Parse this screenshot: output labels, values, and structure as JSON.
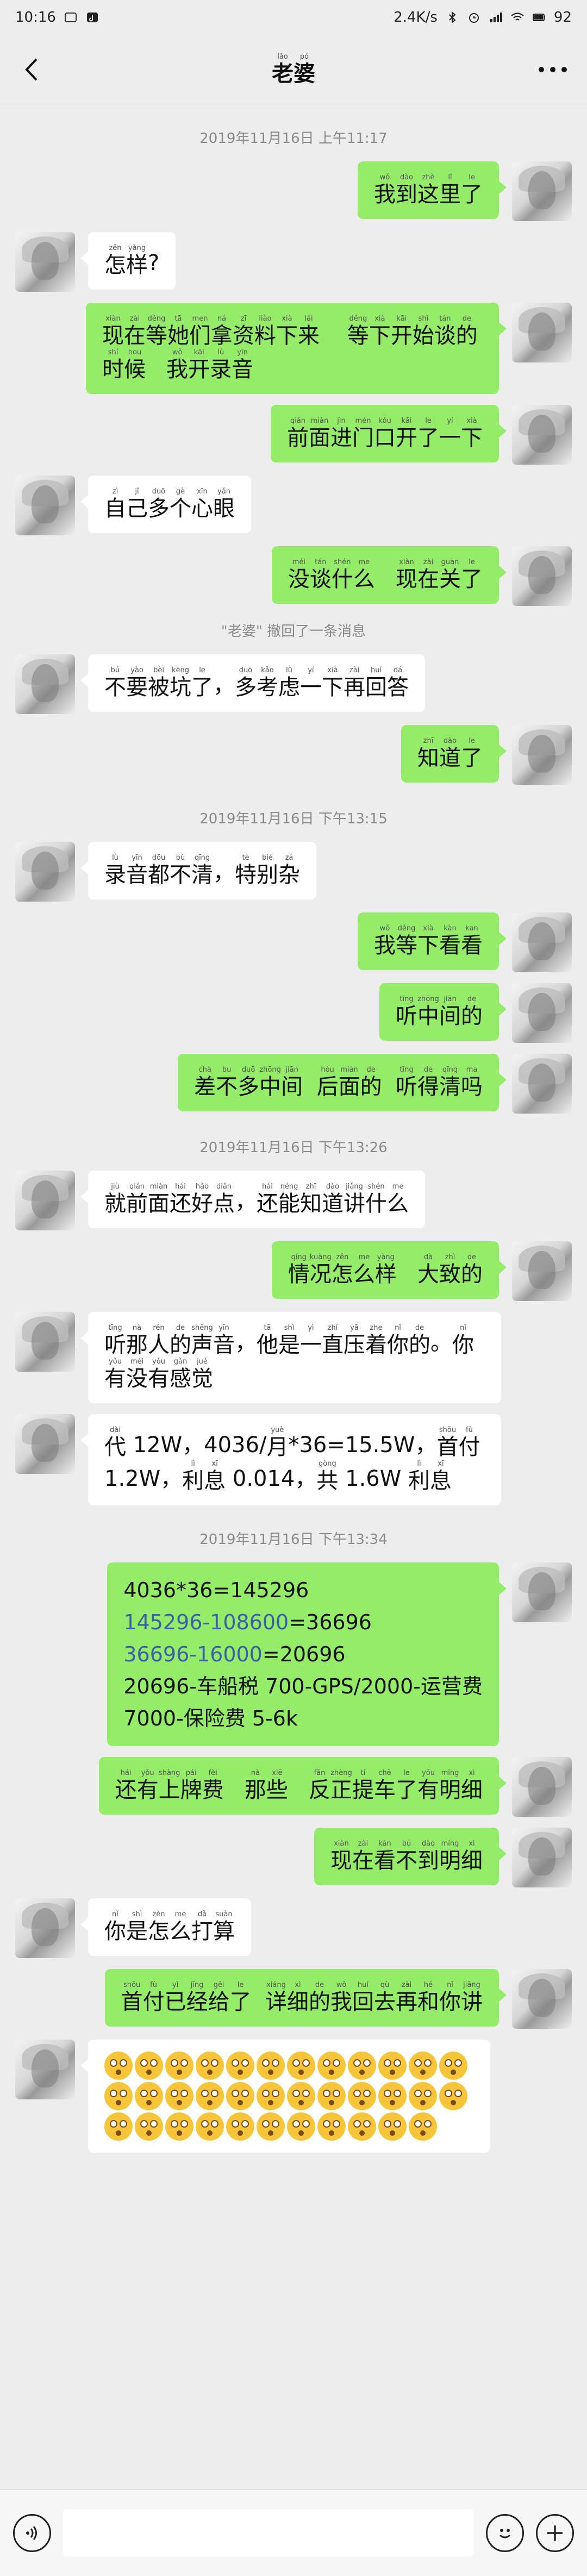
{
  "status": {
    "time": "10:16",
    "speed": "2.4K/s",
    "battery": "92"
  },
  "nav": {
    "title": [
      {
        "py": "lǎo",
        "hz": "老"
      },
      {
        "py": "pó",
        "hz": "婆"
      }
    ],
    "back_icon": "chevron-left-icon",
    "more_icon": "more-dots-icon"
  },
  "messages": [
    {
      "type": "time",
      "text": "2019年11月16日 上午11:17"
    },
    {
      "type": "msg",
      "side": "me",
      "segs": [
        {
          "py": "wǒ",
          "hz": "我"
        },
        {
          "py": "dào",
          "hz": "到"
        },
        {
          "py": "zhè",
          "hz": "这"
        },
        {
          "py": "lǐ",
          "hz": "里"
        },
        {
          "py": "le",
          "hz": "了"
        }
      ]
    },
    {
      "type": "msg",
      "side": "them",
      "segs": [
        {
          "py": "zěn",
          "hz": "怎"
        },
        {
          "py": "yàng",
          "hz": "样"
        },
        {
          "py": "",
          "hz": "?"
        }
      ]
    },
    {
      "type": "msg",
      "side": "me",
      "segs": [
        {
          "py": "xiàn",
          "hz": "现"
        },
        {
          "py": "zài",
          "hz": "在"
        },
        {
          "py": "děng",
          "hz": "等"
        },
        {
          "py": "tā",
          "hz": "她"
        },
        {
          "py": "men",
          "hz": "们"
        },
        {
          "py": "ná",
          "hz": "拿"
        },
        {
          "py": "zī",
          "hz": "资"
        },
        {
          "py": "liào",
          "hz": "料"
        },
        {
          "py": "xià",
          "hz": "下"
        },
        {
          "py": "lái",
          "hz": "来"
        },
        {
          "py": "",
          "hz": "    "
        },
        {
          "py": "děng",
          "hz": "等"
        },
        {
          "py": "xià",
          "hz": "下"
        },
        {
          "py": "kāi",
          "hz": "开"
        },
        {
          "py": "shǐ",
          "hz": "始"
        },
        {
          "py": "tán",
          "hz": "谈"
        },
        {
          "py": "de",
          "hz": "的"
        },
        {
          "py": "shí",
          "hz": "时"
        },
        {
          "py": "hou",
          "hz": "候"
        },
        {
          "py": "",
          "hz": "   "
        },
        {
          "py": "wǒ",
          "hz": "我"
        },
        {
          "py": "kāi",
          "hz": "开"
        },
        {
          "py": "lù",
          "hz": "录"
        },
        {
          "py": "yīn",
          "hz": "音"
        }
      ]
    },
    {
      "type": "msg",
      "side": "me",
      "segs": [
        {
          "py": "qián",
          "hz": "前"
        },
        {
          "py": "miàn",
          "hz": "面"
        },
        {
          "py": "jìn",
          "hz": "进"
        },
        {
          "py": "mén",
          "hz": "门"
        },
        {
          "py": "kǒu",
          "hz": "口"
        },
        {
          "py": "kāi",
          "hz": "开"
        },
        {
          "py": "le",
          "hz": "了"
        },
        {
          "py": "yí",
          "hz": "一"
        },
        {
          "py": "xià",
          "hz": "下"
        }
      ]
    },
    {
      "type": "msg",
      "side": "them",
      "segs": [
        {
          "py": "zì",
          "hz": "自"
        },
        {
          "py": "jǐ",
          "hz": "己"
        },
        {
          "py": "duō",
          "hz": "多"
        },
        {
          "py": "gè",
          "hz": "个"
        },
        {
          "py": "xīn",
          "hz": "心"
        },
        {
          "py": "yǎn",
          "hz": "眼"
        }
      ]
    },
    {
      "type": "msg",
      "side": "me",
      "segs": [
        {
          "py": "méi",
          "hz": "没"
        },
        {
          "py": "tán",
          "hz": "谈"
        },
        {
          "py": "shén",
          "hz": "什"
        },
        {
          "py": "me",
          "hz": "么"
        },
        {
          "py": "",
          "hz": "   "
        },
        {
          "py": "xiàn",
          "hz": "现"
        },
        {
          "py": "zài",
          "hz": "在"
        },
        {
          "py": "guān",
          "hz": "关"
        },
        {
          "py": "le",
          "hz": "了"
        }
      ]
    },
    {
      "type": "recall",
      "text": "\"老婆\" 撤回了一条消息"
    },
    {
      "type": "msg",
      "side": "them",
      "segs": [
        {
          "py": "bú",
          "hz": "不"
        },
        {
          "py": "yào",
          "hz": "要"
        },
        {
          "py": "bèi",
          "hz": "被"
        },
        {
          "py": "kēng",
          "hz": "坑"
        },
        {
          "py": "le",
          "hz": "了"
        },
        {
          "py": "",
          "hz": "，"
        },
        {
          "py": "duō",
          "hz": "多"
        },
        {
          "py": "kǎo",
          "hz": "考"
        },
        {
          "py": "lǜ",
          "hz": "虑"
        },
        {
          "py": "yí",
          "hz": "一"
        },
        {
          "py": "xià",
          "hz": "下"
        },
        {
          "py": "zài",
          "hz": "再"
        },
        {
          "py": "huí",
          "hz": "回"
        },
        {
          "py": "dá",
          "hz": "答"
        }
      ]
    },
    {
      "type": "msg",
      "side": "me",
      "segs": [
        {
          "py": "zhī",
          "hz": "知"
        },
        {
          "py": "dào",
          "hz": "道"
        },
        {
          "py": "le",
          "hz": "了"
        }
      ]
    },
    {
      "type": "time",
      "text": "2019年11月16日 下午13:15"
    },
    {
      "type": "msg",
      "side": "them",
      "segs": [
        {
          "py": "lù",
          "hz": "录"
        },
        {
          "py": "yīn",
          "hz": "音"
        },
        {
          "py": "dōu",
          "hz": "都"
        },
        {
          "py": "bù",
          "hz": "不"
        },
        {
          "py": "qīng",
          "hz": "清"
        },
        {
          "py": "",
          "hz": "，"
        },
        {
          "py": "tè",
          "hz": "特"
        },
        {
          "py": "bié",
          "hz": "别"
        },
        {
          "py": "zá",
          "hz": "杂"
        }
      ]
    },
    {
      "type": "msg",
      "side": "me",
      "segs": [
        {
          "py": "wǒ",
          "hz": "我"
        },
        {
          "py": "děng",
          "hz": "等"
        },
        {
          "py": "xià",
          "hz": "下"
        },
        {
          "py": "kàn",
          "hz": "看"
        },
        {
          "py": "kan",
          "hz": "看"
        }
      ]
    },
    {
      "type": "msg",
      "side": "me",
      "segs": [
        {
          "py": "tīng",
          "hz": "听"
        },
        {
          "py": "zhōng",
          "hz": "中"
        },
        {
          "py": "jiān",
          "hz": "间"
        },
        {
          "py": "de",
          "hz": "的"
        }
      ]
    },
    {
      "type": "msg",
      "side": "me",
      "segs": [
        {
          "py": "chà",
          "hz": "差"
        },
        {
          "py": "bu",
          "hz": "不"
        },
        {
          "py": "duō",
          "hz": "多"
        },
        {
          "py": "zhōng",
          "hz": "中"
        },
        {
          "py": "jiān",
          "hz": "间"
        },
        {
          "py": "",
          "hz": "  "
        },
        {
          "py": "hòu",
          "hz": "后"
        },
        {
          "py": "miàn",
          "hz": "面"
        },
        {
          "py": "de",
          "hz": "的"
        },
        {
          "py": "",
          "hz": "  "
        },
        {
          "py": "tīng",
          "hz": "听"
        },
        {
          "py": "de",
          "hz": "得"
        },
        {
          "py": "qīng",
          "hz": "清"
        },
        {
          "py": "ma",
          "hz": "吗"
        }
      ]
    },
    {
      "type": "time",
      "text": "2019年11月16日 下午13:26"
    },
    {
      "type": "msg",
      "side": "them",
      "segs": [
        {
          "py": "jiù",
          "hz": "就"
        },
        {
          "py": "qián",
          "hz": "前"
        },
        {
          "py": "miàn",
          "hz": "面"
        },
        {
          "py": "hái",
          "hz": "还"
        },
        {
          "py": "hǎo",
          "hz": "好"
        },
        {
          "py": "diǎn",
          "hz": "点"
        },
        {
          "py": "",
          "hz": "，"
        },
        {
          "py": "hái",
          "hz": "还"
        },
        {
          "py": "néng",
          "hz": "能"
        },
        {
          "py": "zhī",
          "hz": "知"
        },
        {
          "py": "dào",
          "hz": "道"
        },
        {
          "py": "jiǎng",
          "hz": "讲"
        },
        {
          "py": "shén",
          "hz": "什"
        },
        {
          "py": "me",
          "hz": "么"
        }
      ]
    },
    {
      "type": "msg",
      "side": "me",
      "segs": [
        {
          "py": "qíng",
          "hz": "情"
        },
        {
          "py": "kuàng",
          "hz": "况"
        },
        {
          "py": "zěn",
          "hz": "怎"
        },
        {
          "py": "me",
          "hz": "么"
        },
        {
          "py": "yàng",
          "hz": "样"
        },
        {
          "py": "",
          "hz": "   "
        },
        {
          "py": "dà",
          "hz": "大"
        },
        {
          "py": "zhì",
          "hz": "致"
        },
        {
          "py": "de",
          "hz": "的"
        }
      ]
    },
    {
      "type": "msg",
      "side": "them",
      "segs": [
        {
          "py": "tīng",
          "hz": "听"
        },
        {
          "py": "nà",
          "hz": "那"
        },
        {
          "py": "rén",
          "hz": "人"
        },
        {
          "py": "de",
          "hz": "的"
        },
        {
          "py": "shēng",
          "hz": "声"
        },
        {
          "py": "yīn",
          "hz": "音"
        },
        {
          "py": "",
          "hz": "，"
        },
        {
          "py": "tā",
          "hz": "他"
        },
        {
          "py": "shì",
          "hz": "是"
        },
        {
          "py": "yì",
          "hz": "一"
        },
        {
          "py": "zhí",
          "hz": "直"
        },
        {
          "py": "yā",
          "hz": "压"
        },
        {
          "py": "zhe",
          "hz": "着"
        },
        {
          "py": "nǐ",
          "hz": "你"
        },
        {
          "py": "de",
          "hz": "的"
        },
        {
          "py": "",
          "hz": "。"
        },
        {
          "py": "nǐ",
          "hz": "你"
        },
        {
          "py": "yǒu",
          "hz": "有"
        },
        {
          "py": "méi",
          "hz": "没"
        },
        {
          "py": "yǒu",
          "hz": "有"
        },
        {
          "py": "gǎn",
          "hz": "感"
        },
        {
          "py": "jué",
          "hz": "觉"
        }
      ]
    },
    {
      "type": "msg",
      "side": "them",
      "segs": [
        {
          "py": "dài",
          "hz": "代"
        },
        {
          "py": "",
          "hz": " 12W，4036/"
        },
        {
          "py": "yuè",
          "hz": "月"
        },
        {
          "py": "",
          "hz": "*36=15.5W，"
        },
        {
          "py": "shǒu",
          "hz": "首"
        },
        {
          "py": "fù",
          "hz": "付"
        },
        {
          "py": "",
          "hz": " 1.2W，"
        },
        {
          "py": "lì",
          "hz": "利"
        },
        {
          "py": "xī",
          "hz": "息"
        },
        {
          "py": "",
          "hz": " 0.014，"
        },
        {
          "py": "gòng",
          "hz": "共"
        },
        {
          "py": "",
          "hz": " 1.6W "
        },
        {
          "py": "lì",
          "hz": "利"
        },
        {
          "py": "xī",
          "hz": "息"
        }
      ]
    },
    {
      "type": "time",
      "text": "2019年11月16日 下午13:34"
    },
    {
      "type": "calc",
      "side": "me",
      "lines": [
        {
          "text": "4036*36=145296",
          "link": false
        },
        {
          "link_part": "145296-108600",
          "rest": "=36696"
        },
        {
          "link_part": "36696-16000",
          "rest": "=20696"
        },
        {
          "text": "20696-车船税 700-GPS/2000-运营费",
          "link": false
        },
        {
          "text": "7000-保险费 5-6k",
          "link": false
        }
      ]
    },
    {
      "type": "msg",
      "side": "me",
      "segs": [
        {
          "py": "hái",
          "hz": "还"
        },
        {
          "py": "yǒu",
          "hz": "有"
        },
        {
          "py": "shàng",
          "hz": "上"
        },
        {
          "py": "pái",
          "hz": "牌"
        },
        {
          "py": "fèi",
          "hz": "费"
        },
        {
          "py": "",
          "hz": "   "
        },
        {
          "py": "nà",
          "hz": "那"
        },
        {
          "py": "xiē",
          "hz": "些"
        },
        {
          "py": "",
          "hz": "   "
        },
        {
          "py": "fǎn",
          "hz": "反"
        },
        {
          "py": "zhèng",
          "hz": "正"
        },
        {
          "py": "tí",
          "hz": "提"
        },
        {
          "py": "chē",
          "hz": "车"
        },
        {
          "py": "le",
          "hz": "了"
        },
        {
          "py": "yǒu",
          "hz": "有"
        },
        {
          "py": "míng",
          "hz": "明"
        },
        {
          "py": "xì",
          "hz": "细"
        }
      ]
    },
    {
      "type": "msg",
      "side": "me",
      "segs": [
        {
          "py": "xiàn",
          "hz": "现"
        },
        {
          "py": "zài",
          "hz": "在"
        },
        {
          "py": "kàn",
          "hz": "看"
        },
        {
          "py": "bú",
          "hz": "不"
        },
        {
          "py": "dào",
          "hz": "到"
        },
        {
          "py": "míng",
          "hz": "明"
        },
        {
          "py": "xì",
          "hz": "细"
        }
      ]
    },
    {
      "type": "msg",
      "side": "them",
      "segs": [
        {
          "py": "nǐ",
          "hz": "你"
        },
        {
          "py": "shì",
          "hz": "是"
        },
        {
          "py": "zěn",
          "hz": "怎"
        },
        {
          "py": "me",
          "hz": "么"
        },
        {
          "py": "dǎ",
          "hz": "打"
        },
        {
          "py": "suàn",
          "hz": "算"
        }
      ]
    },
    {
      "type": "msg",
      "side": "me",
      "segs": [
        {
          "py": "shǒu",
          "hz": "首"
        },
        {
          "py": "fù",
          "hz": "付"
        },
        {
          "py": "yǐ",
          "hz": "已"
        },
        {
          "py": "jīng",
          "hz": "经"
        },
        {
          "py": "gěi",
          "hz": "给"
        },
        {
          "py": "le",
          "hz": "了"
        },
        {
          "py": "",
          "hz": "  "
        },
        {
          "py": "xiáng",
          "hz": "详"
        },
        {
          "py": "xì",
          "hz": "细"
        },
        {
          "py": "de",
          "hz": "的"
        },
        {
          "py": "wǒ",
          "hz": "我"
        },
        {
          "py": "huí",
          "hz": "回"
        },
        {
          "py": "qù",
          "hz": "去"
        },
        {
          "py": "zài",
          "hz": "再"
        },
        {
          "py": "hé",
          "hz": "和"
        },
        {
          "py": "nǐ",
          "hz": "你"
        },
        {
          "py": "jiǎng",
          "hz": "讲"
        }
      ]
    },
    {
      "type": "emoji",
      "side": "them",
      "count": 35,
      "emoji_name": "flushed-face-icon"
    }
  ],
  "input": {
    "voice_icon": "voice-icon",
    "emoji_icon": "emoji-icon",
    "plus_icon": "plus-icon"
  },
  "colors": {
    "bg": "#ededed",
    "me_bubble": "#95ec69",
    "them_bubble": "#ffffff",
    "link": "#3b5ea8"
  }
}
